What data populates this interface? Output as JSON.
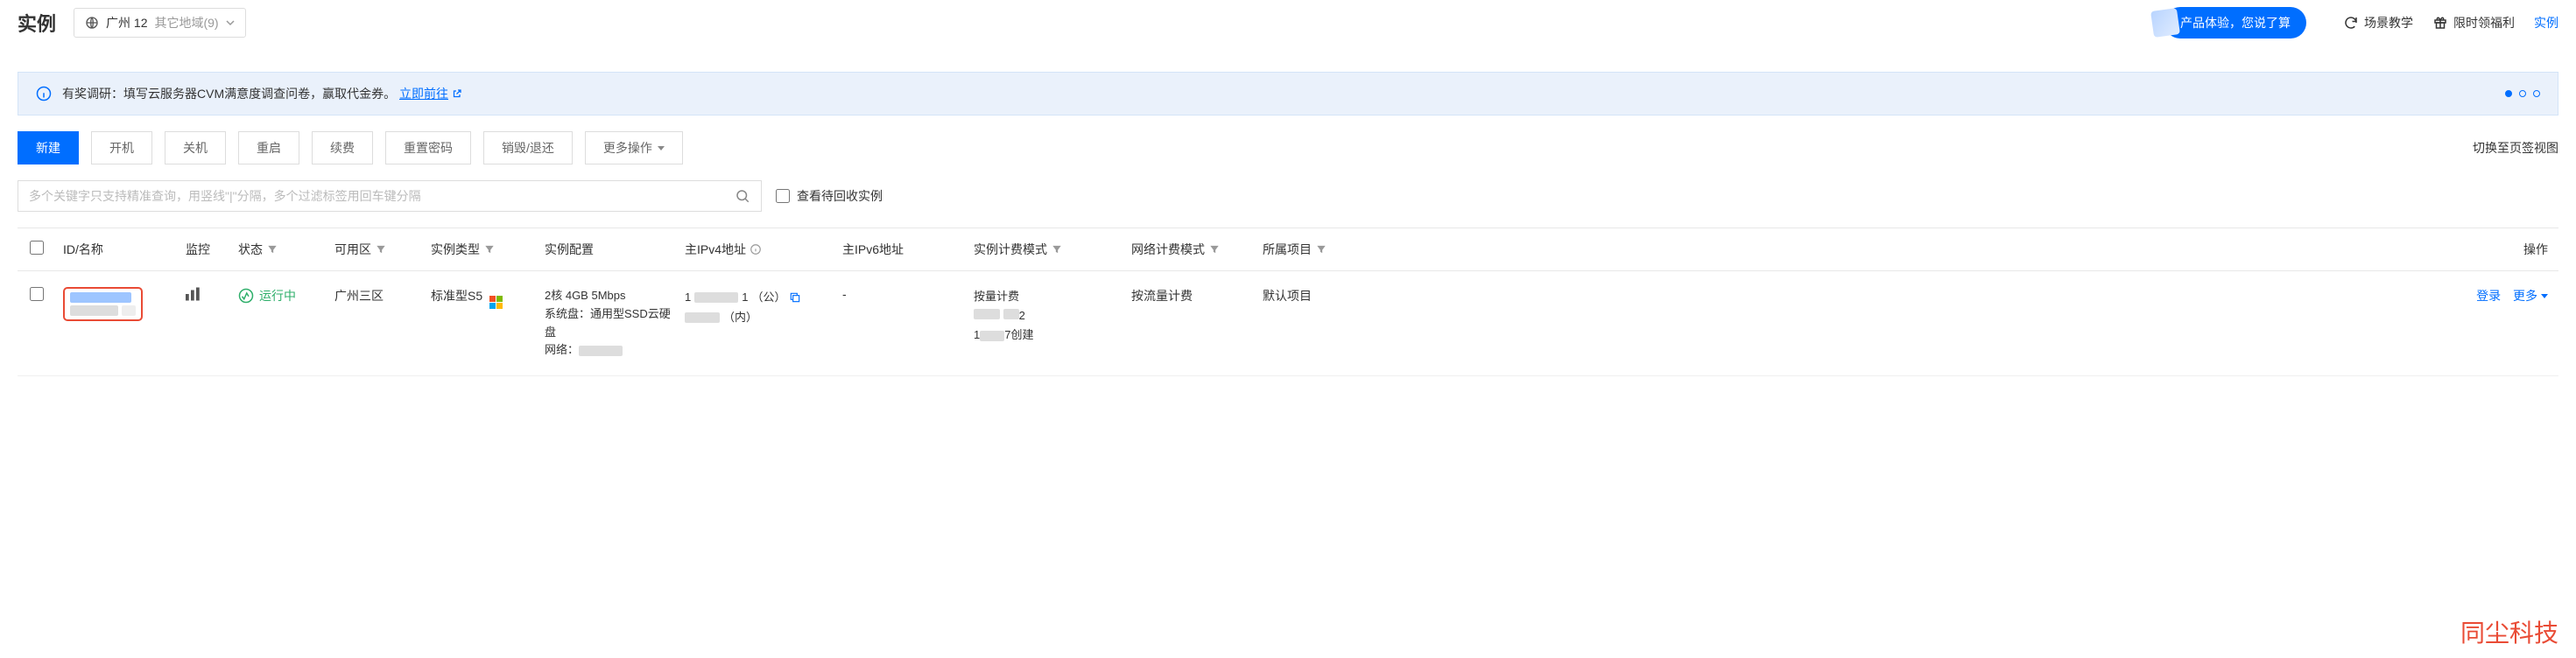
{
  "header": {
    "title": "实例",
    "region_current": "广州 12",
    "region_other": "其它地域(9)",
    "promo_text": "产品体验，您说了算",
    "links": {
      "tutorial": "场景教学",
      "benefit": "限时领福利",
      "instance_right": "实例"
    }
  },
  "banner": {
    "prefix": "有奖调研：填写云服务器CVM满意度调查问卷，赢取代金券。",
    "link_text": "立即前往"
  },
  "toolbar": {
    "create": "新建",
    "start": "开机",
    "stop": "关机",
    "restart": "重启",
    "renew": "续费",
    "reset_pwd": "重置密码",
    "destroy": "销毁/退还",
    "more": "更多操作",
    "view_switch": "切换至页签视图"
  },
  "search": {
    "placeholder": "多个关键字只支持精准查询，用竖线\"|\"分隔，多个过滤标签用回车键分隔",
    "recycle_label": "查看待回收实例"
  },
  "columns": {
    "id": "ID/名称",
    "monitor": "监控",
    "status": "状态",
    "zone": "可用区",
    "type": "实例类型",
    "config": "实例配置",
    "ipv4": "主IPv4地址",
    "ipv6": "主IPv6地址",
    "billing": "实例计费模式",
    "net_billing": "网络计费模式",
    "project": "所属项目",
    "ops": "操作"
  },
  "rows": [
    {
      "status": "运行中",
      "zone": "广州三区",
      "type": "标准型S5",
      "config_line1": "2核 4GB 5Mbps",
      "config_line2": "系统盘：通用型SSD云硬盘",
      "config_line3": "网络：",
      "ipv4_pub_suffix": "（公）",
      "ipv4_pri_suffix": "（内）",
      "ipv6": "-",
      "billing_mode": "按量计费",
      "billing_created_suffix": "创建",
      "net_billing": "按流量计费",
      "project": "默认项目",
      "op_login": "登录",
      "op_more": "更多"
    }
  ],
  "watermark": "同尘科技"
}
